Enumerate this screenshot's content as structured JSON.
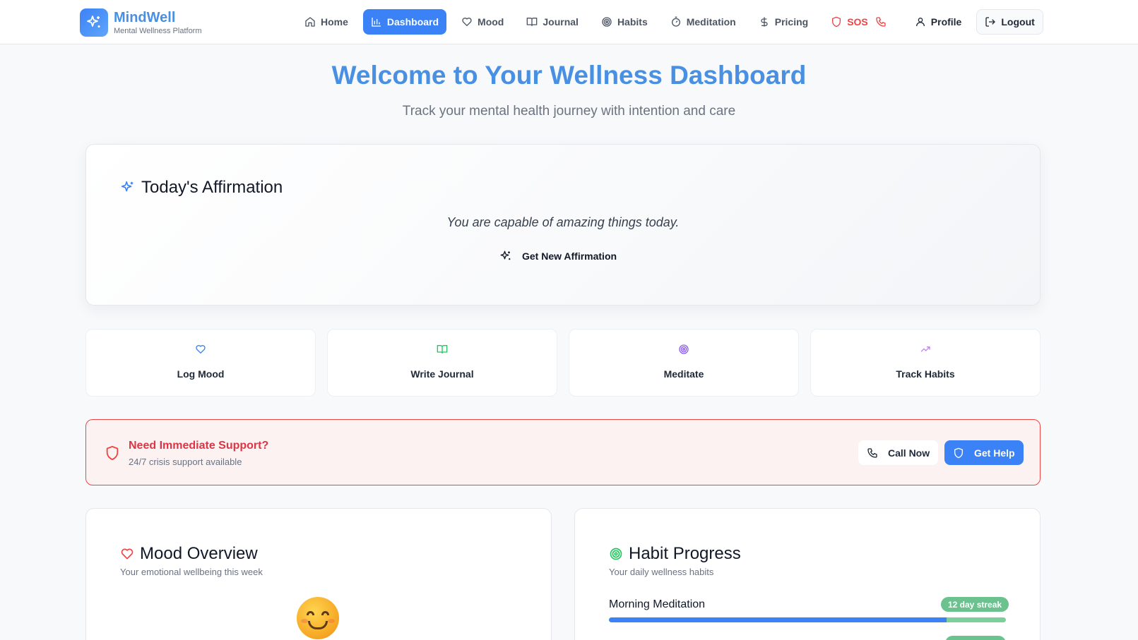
{
  "brand": {
    "name": "MindWell",
    "tagline": "Mental Wellness Platform"
  },
  "nav": {
    "home": "Home",
    "dashboard": "Dashboard",
    "mood": "Mood",
    "journal": "Journal",
    "habits": "Habits",
    "meditation": "Meditation",
    "pricing": "Pricing",
    "sos": "SOS",
    "profile": "Profile",
    "logout": "Logout",
    "active": "Dashboard"
  },
  "hero": {
    "title": "Welcome to Your Wellness Dashboard",
    "subtitle": "Track your mental health journey with intention and care"
  },
  "affirmation": {
    "title": "Today's Affirmation",
    "text": "You are capable of amazing things today.",
    "button": "Get New Affirmation"
  },
  "quick_actions": [
    {
      "label": "Log Mood",
      "icon": "heart-icon",
      "color": "#3b82f6"
    },
    {
      "label": "Write Journal",
      "icon": "book-icon",
      "color": "#22c55e"
    },
    {
      "label": "Meditate",
      "icon": "target-icon",
      "color": "#8b5cf6"
    },
    {
      "label": "Track Habits",
      "icon": "trending-up-icon",
      "color": "#c084fc"
    }
  ],
  "support": {
    "title": "Need Immediate Support?",
    "subtitle": "24/7 crisis support available",
    "call_button": "Call Now",
    "help_button": "Get Help"
  },
  "mood_overview": {
    "title": "Mood Overview",
    "subtitle": "Your emotional wellbeing this week",
    "current_mood_icon": "smiling-face-emoji"
  },
  "habit_progress": {
    "title": "Habit Progress",
    "subtitle": "Your daily wellness habits",
    "habits": [
      {
        "name": "Morning Meditation",
        "streak": "12 day streak",
        "progress": 0.85
      }
    ]
  },
  "colors": {
    "primary": "#3b82f6",
    "brand_text": "#4a90e2",
    "danger": "#ef4444",
    "success": "#6cc28f"
  }
}
